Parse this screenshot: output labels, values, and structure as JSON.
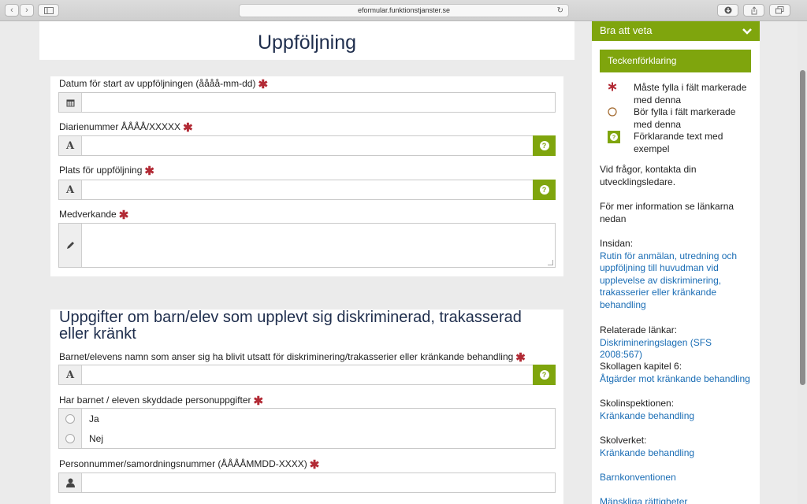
{
  "browser": {
    "url": "eformular.funktionstjanster.se",
    "back_glyph": "‹",
    "forward_glyph": "›",
    "reload_glyph": "↻"
  },
  "form": {
    "title": "Uppföljning",
    "fields": {
      "datum": {
        "label": "Datum för start av uppföljningen (åååå-mm-dd)",
        "icon": "calendar-icon"
      },
      "diarienummer": {
        "label": "Diarienummer ÅÅÅÅ/XXXXX",
        "icon": "text-icon",
        "addon": "A"
      },
      "plats": {
        "label": "Plats för uppföljning",
        "icon": "text-icon",
        "addon": "A"
      },
      "medverkande": {
        "label": "Medverkande",
        "icon": "pencil-icon"
      }
    },
    "section2": {
      "heading": "Uppgifter om barn/elev som upplevt sig diskriminerad, trakasserad eller kränkt",
      "namn_label": "Barnet/elevens namn som anser sig ha blivit utsatt för diskriminering/trakasserier eller kränkande behandling",
      "namn_addon": "A",
      "skyddade_label": "Har barnet / eleven skyddade personuppgifter",
      "options": [
        "Ja",
        "Nej"
      ],
      "personnummer_label": "Personnummer/samordningsnummer (ÅÅÅÅMMDD-XXXX)"
    },
    "required_marker": "✱",
    "help_glyph": "?"
  },
  "sidebar": {
    "header": "Bra att veta",
    "legend_title": "Teckenförklaring",
    "legend": [
      {
        "icon": "asterisk-icon",
        "text": "Måste fylla i fält markerade med denna"
      },
      {
        "icon": "circle-icon",
        "text": "Bör fylla i fält markerade med denna"
      },
      {
        "icon": "help-icon",
        "text": "Förklarande text med exempel"
      }
    ],
    "contact": "Vid frågor, kontakta din utvecklingsledare.",
    "more_info": "För mer information se länkarna nedan",
    "insidan_label": "Insidan:",
    "insidan_link": "Rutin för anmälan, utredning och uppföljning till huvudman vid upplevelse av diskriminering, trakasserier eller kränkande behandling",
    "related_label": "Relaterade länkar:",
    "related_link": "Diskrimineringslagen (SFS 2008:567)",
    "skollagen_label": "Skollagen kapitel 6:",
    "skollagen_link": "Åtgärder mot kränkande behandling",
    "skolinsp_label": "Skolinspektionen:",
    "skolinsp_link": "Kränkande behandling",
    "skolverket_label": "Skolverket:",
    "skolverket_link": "Kränkande behandling",
    "barnkonv_link": "Barnkonventionen",
    "mansk_link": "Mänskliga rättigheter"
  },
  "colors": {
    "accent_green": "#7fa50d",
    "required_red": "#b22a35",
    "link_blue": "#1a6db5",
    "heading_navy": "#1f2e4d"
  }
}
